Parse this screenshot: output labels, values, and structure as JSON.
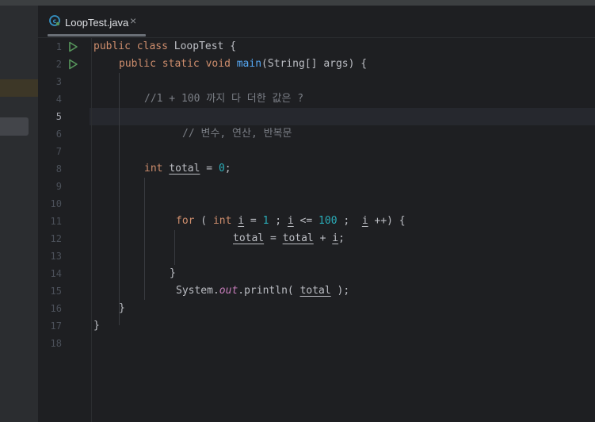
{
  "tab": {
    "title": "LoopTest.java",
    "close": "×"
  },
  "gutter": {
    "line_numbers": [
      "1",
      "2",
      "3",
      "4",
      "5",
      "6",
      "7",
      "8",
      "9",
      "10",
      "11",
      "12",
      "13",
      "14",
      "15",
      "16",
      "17",
      "18"
    ],
    "current_line": 5
  },
  "code": {
    "l1": {
      "kw1": "public",
      "kw2": "class",
      "rest": " LoopTest {"
    },
    "l2": {
      "kw1": "public",
      "kw2": "static",
      "kw3": "void",
      "fn": "main",
      "rest": "(String[] args) {"
    },
    "l4": {
      "comment": "//1 + 100 까지 다 더한 값은 ?"
    },
    "l6": {
      "comment": "// 변수, 연산, 반복문"
    },
    "l8": {
      "kw": "int",
      "var": "total",
      "eq": " = ",
      "num": "0",
      "end": ";"
    },
    "l11": {
      "kw": "for",
      "p1": " ( ",
      "kw2": "int",
      "v1": "i",
      "p2": " = ",
      "n1": "1",
      "p3": " ; ",
      "v2": "i",
      "p4": " <= ",
      "n2": "100",
      "p5": " ;  ",
      "v3": "i",
      "p6": " ++) {"
    },
    "l12": {
      "v1": "total",
      "p1": " = ",
      "v2": "total",
      "p2": " + ",
      "v3": "i",
      "p3": ";"
    },
    "l14": {
      "text": "}"
    },
    "l15": {
      "a": "System.",
      "b": "out",
      "c": ".println( ",
      "d": "total",
      "e": " );"
    },
    "l16": {
      "text": "}"
    },
    "l17": {
      "text": "}"
    }
  },
  "colors": {
    "keyword": "#cf8e6d",
    "number": "#2aacb8",
    "comment": "#7a7e85",
    "method": "#56a8f5",
    "static_field": "#c77dbb",
    "run_icon": "#57965c"
  }
}
